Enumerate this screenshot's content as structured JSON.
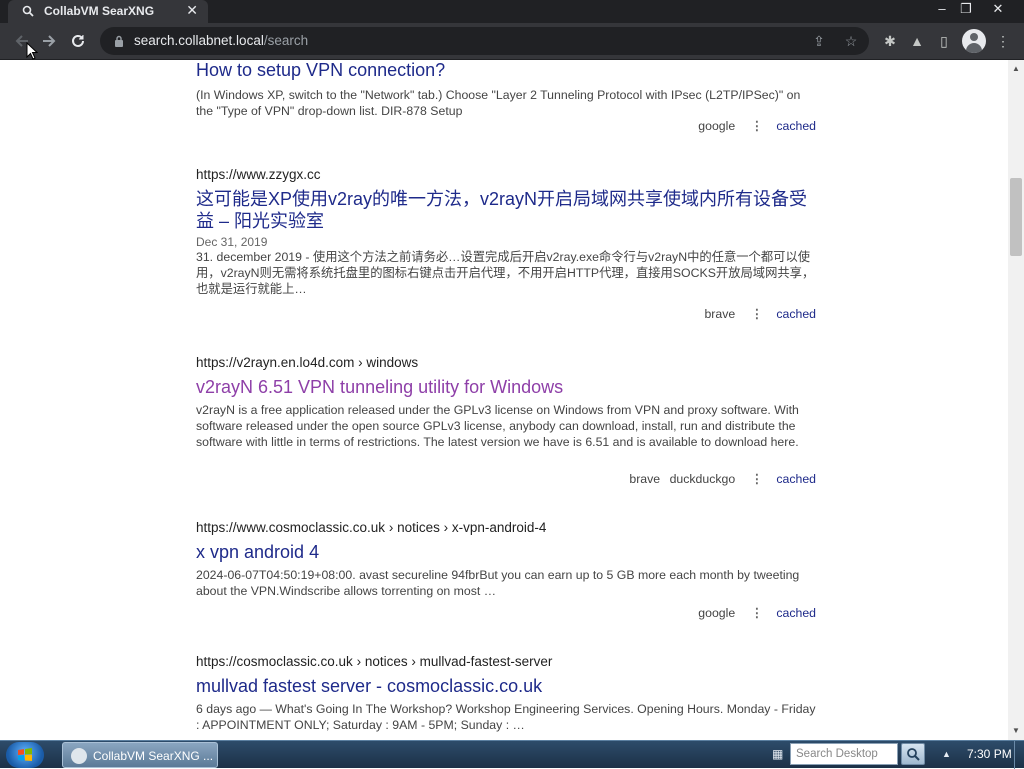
{
  "browser": {
    "tab_title": "CollabVM SearXNG",
    "tab_close": "✕",
    "url_host": "search.collabnet.local",
    "url_path": "/search",
    "window_controls": [
      "‒",
      "❐",
      "✕"
    ]
  },
  "results": [
    {
      "url": "",
      "crumbs": "",
      "title": "How to setup VPN connection?",
      "date": "",
      "content": "(In Windows XP, switch to the \"Network\" tab.) Choose \"Layer 2 Tunneling Protocol with IPsec (L2TP/IPSec)\" on the \"Type of VPN\" drop-down list. DIR-878 Setup",
      "engines": [
        "google"
      ],
      "cached": "cached"
    },
    {
      "url": "https://www.zzygx.cc",
      "crumbs": "",
      "title": "这可能是XP使用v2ray的唯一方法，v2rayN开启局域网共享使域内所有设备受益 – 阳光实验室",
      "date": "Dec 31, 2019",
      "content": "31. december 2019 - 使用这个方法之前请务必…设置完成后开启v2ray.exe命令行与v2rayN中的任意一个都可以使用，v2rayN则无需将系统托盘里的图标右键点击开启代理，不用开启HTTP代理，直接用SOCKS开放局域网共享，也就是运行就能上…",
      "engines": [
        "brave"
      ],
      "cached": "cached"
    },
    {
      "url": "https://v2rayn.en.lo4d.com",
      "crumbs": "› windows",
      "title": "v2rayN 6.51 VPN tunneling utility for Windows",
      "date": "",
      "content": "v2rayN is a free application released under the GPLv3 license on Windows from VPN and proxy software. With software released under the open source GPLv3 license, anybody can download, install, run and distribute the software with little in terms of restrictions. The latest version we have is 6.51 and is available to download here.",
      "engines": [
        "brave",
        "duckduckgo"
      ],
      "cached": "cached"
    },
    {
      "url": "https://www.cosmoclassic.co.uk",
      "crumbs": "› notices › x-vpn-android-4",
      "title": "x vpn android 4",
      "date": "",
      "content": "2024-06-07T04:50:19+08:00. avast secureline 94fbrBut you can earn up to 5 GB more each month by tweeting about the VPN.Windscribe allows torrenting on most …",
      "engines": [
        "google"
      ],
      "cached": "cached"
    },
    {
      "url": "https://cosmoclassic.co.uk",
      "crumbs": "› notices › mullvad-fastest-server",
      "title": "mullvad fastest server - cosmoclassic.co.uk",
      "date": "",
      "content": "6 days ago — What's Going In The Workshop? Workshop Engineering Services. Opening Hours. Monday - Friday : APPOINTMENT ONLY; Saturday : 9AM - 5PM; Sunday : …",
      "engines": [],
      "cached": ""
    }
  ],
  "taskbar": {
    "task_label": "CollabVM SearXNG ...",
    "search_placeholder": "Search Desktop",
    "clock": "7:30 PM"
  }
}
